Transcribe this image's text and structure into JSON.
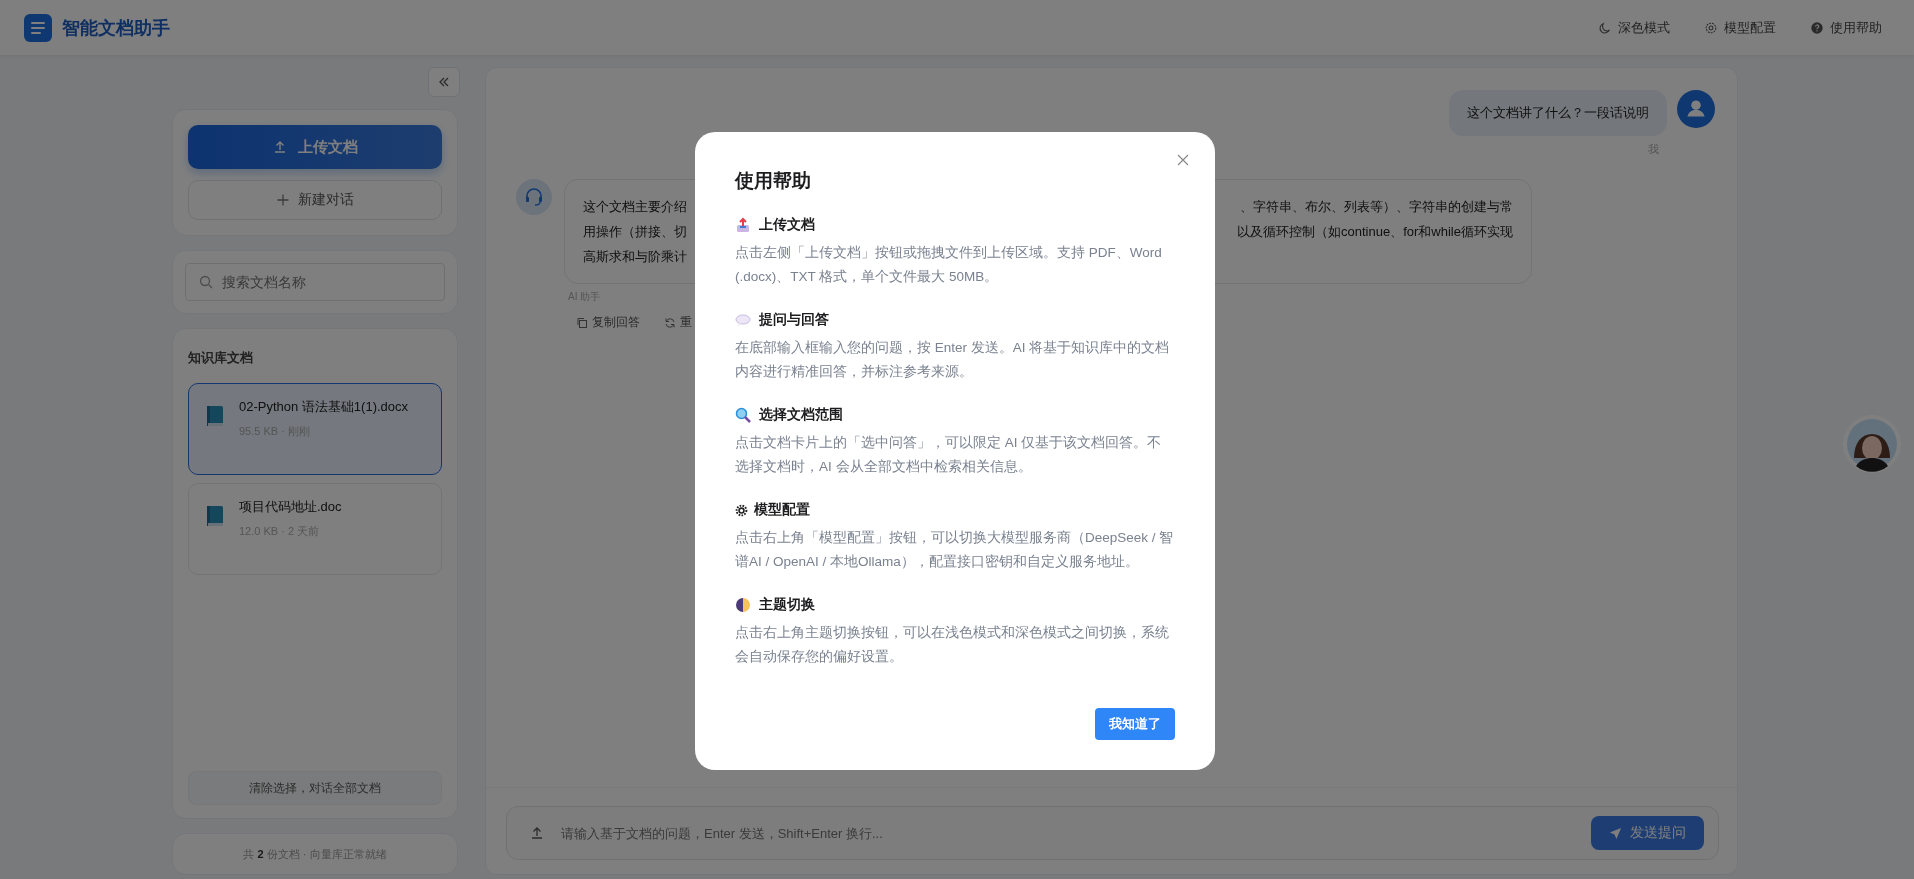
{
  "header": {
    "title": "智能文档助手",
    "actions": [
      {
        "kind": "theme",
        "label": "深色模式"
      },
      {
        "kind": "settings",
        "label": "模型配置"
      },
      {
        "kind": "help",
        "label": "使用帮助"
      }
    ]
  },
  "sidebar": {
    "upload_button": "上传文档",
    "new_chat_button": "新建对话",
    "search": {
      "placeholder": "搜索文档名称"
    },
    "docs_title": "知识库文档",
    "documents": [
      {
        "name": "02-Python 语法基础1(1).docx",
        "meta": "95.5 KB · 刚刚",
        "selected": true
      },
      {
        "name": "项目代码地址.doc",
        "meta": "12.0 KB · 2 天前",
        "selected": false
      }
    ],
    "clear_button": "清除选择，对话全部文档",
    "footer": "共 **2** 份文档 · 向量库正常就绪"
  },
  "chat": {
    "messages": [
      {
        "kind": "user",
        "text": "这个文档讲了什么？一段话说明",
        "sender": "我"
      },
      {
        "kind": "assistant",
        "lines": [
          {
            "left": "这个文档主要介绍",
            "right": "、字符串、布尔、列表等）、字符串的创建与常"
          },
          {
            "left": "用操作（拼接、切",
            "right": "以及循环控制（如continue、for和while循环实现"
          },
          {
            "left": "高斯求和与阶乘计"
          }
        ],
        "sender": "AI 助手",
        "actions": [
          {
            "kind": "copy",
            "label": "复制回答"
          },
          {
            "kind": "regenerate",
            "label": "重"
          }
        ]
      }
    ],
    "input": {
      "placeholder": "请输入基于文档的问题，Enter 发送，Shift+Enter 换行..."
    },
    "send_button": "发送提问"
  },
  "help_dialog": {
    "title": "使用帮助",
    "sections": [
      {
        "kind": "upload",
        "heading": "上传文档",
        "body": "点击左侧「上传文档」按钮或拖拽文件到上传区域。支持 PDF、Word (.docx)、TXT 格式，单个文件最大 50MB。"
      },
      {
        "kind": "chat",
        "heading": "提问与回答",
        "body": "在底部输入框输入您的问题，按 Enter 发送。AI 将基于知识库中的文档内容进行精准回答，并标注参考来源。"
      },
      {
        "kind": "search",
        "heading": "选择文档范围",
        "body": "点击文档卡片上的「选中问答」，可以限定 AI 仅基于该文档回答。不选择文档时，AI 会从全部文档中检索相关信息。"
      },
      {
        "kind": "settings",
        "heading": "模型配置",
        "body": "点击右上角「模型配置」按钮，可以切换大模型服务商（DeepSeek / 智谱AI / OpenAI / 本地Ollama），配置接口密钥和自定义服务地址。"
      },
      {
        "kind": "theme",
        "heading": "主题切换",
        "body": "点击右上角主题切换按钮，可以在浅色模式和深色模式之间切换，系统会自动保存您的偏好设置。"
      }
    ],
    "confirm_button": "我知道了"
  }
}
